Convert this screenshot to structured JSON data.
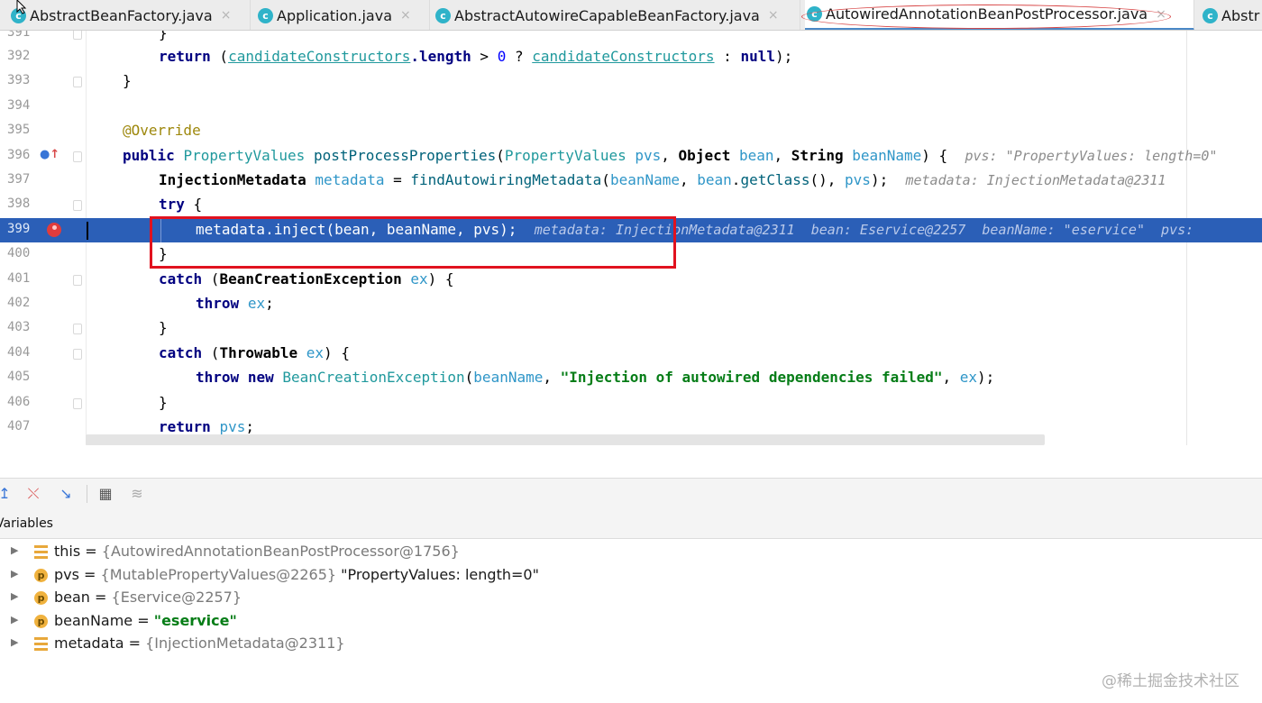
{
  "tabs": [
    {
      "label": "AbstractBeanFactory.java",
      "icon": "class-icon",
      "active": false
    },
    {
      "label": "Application.java",
      "icon": "class-icon",
      "active": false
    },
    {
      "label": "AbstractAutowireCapableBeanFactory.java",
      "icon": "class-icon",
      "active": false
    },
    {
      "label": "AutowiredAnnotationBeanPostProcessor.java",
      "icon": "class-icon",
      "active": true
    },
    {
      "label": "Abstr",
      "icon": "class-icon",
      "active": false
    }
  ],
  "tab_close_glyph": "×",
  "class_icon_letter": "c",
  "code": {
    "line_numbers": [
      "391",
      "392",
      "393",
      "394",
      "395",
      "396",
      "397",
      "398",
      "399",
      "400",
      "401",
      "402",
      "403",
      "404",
      "405",
      "406",
      "407"
    ],
    "l391": {
      "brace": "}"
    },
    "l392": {
      "return": "return",
      "open": " (",
      "field1": "candidateConstructors",
      "dot": ".length",
      "op": " > ",
      "zero": "0",
      "q": " ? ",
      "field2": "candidateConstructors",
      "colon": " : ",
      "null": "null",
      "close": ");"
    },
    "l393": {
      "brace": "}"
    },
    "l395": {
      "annotation": "@Override"
    },
    "l396": {
      "public": "public ",
      "rtype": "PropertyValues",
      "method": "postProcessProperties",
      "p1type": "PropertyValues",
      "p1": "pvs",
      "comma1": ", ",
      "p2type": "Object",
      "p2": "bean",
      "p3type": "String",
      "p3": "beanName",
      "end": ") {",
      "hint": "pvs: \"PropertyValues: length=0\""
    },
    "l397": {
      "type": "InjectionMetadata",
      "var": "metadata",
      "eq": " = ",
      "call": "findAutowiringMetadata",
      "a1": "beanName",
      "a2": "bean",
      "getclass": "getClass",
      "a3": "pvs",
      "end": ");",
      "hint": "metadata: InjectionMetadata@2311"
    },
    "l398": {
      "try": "try",
      "brace": " {"
    },
    "l399": {
      "stmt": "metadata.inject(bean, beanName, pvs);",
      "hint": "metadata: InjectionMetadata@2311  bean: Eservice@2257  beanName: \"eservice\"  pvs:"
    },
    "l400": {
      "brace": "}"
    },
    "l401": {
      "catch": "catch",
      "exc": "BeanCreationException",
      "ex": "ex",
      "end": ") {"
    },
    "l402": {
      "throw": "throw",
      "ex": "ex",
      "end": ";"
    },
    "l403": {
      "brace": "}"
    },
    "l404": {
      "catch": "catch",
      "exc": "Throwable",
      "ex": "ex",
      "end": ") {"
    },
    "l405": {
      "throw": "throw",
      "new": "new",
      "exc": "BeanCreationException",
      "a1": "beanName",
      "msg": "\"Injection of autowired dependencies failed\"",
      "ex": "ex",
      "end": ");"
    },
    "l406": {
      "brace": "}"
    },
    "l407": {
      "return": "return",
      "pvs": "pvs",
      "end": ";"
    }
  },
  "debug": {
    "toolbar": [
      "show-execution-point-icon",
      "drop-frame-icon",
      "step-into-icon",
      "evaluate-grid-icon",
      "trace-icon"
    ],
    "variables_title": "Variables",
    "variables": [
      {
        "icon": "field-list-icon",
        "name": "this",
        "eq": " = ",
        "type": "{AutowiredAnnotationBeanPostProcessor@1756}",
        "value": ""
      },
      {
        "icon": "parameter-icon",
        "name": "pvs",
        "eq": " = ",
        "type": "{MutablePropertyValues@2265}",
        "value": " \"PropertyValues: length=0\""
      },
      {
        "icon": "parameter-icon",
        "name": "bean",
        "eq": " = ",
        "type": "{Eservice@2257}",
        "value": ""
      },
      {
        "icon": "parameter-icon",
        "name": "beanName",
        "eq": " = ",
        "type": "",
        "value": "\"eservice\""
      },
      {
        "icon": "field-list-icon",
        "name": "metadata",
        "eq": " = ",
        "type": "{InjectionMetadata@2311}",
        "value": ""
      }
    ],
    "param_letter": "p"
  },
  "watermark": "@稀土掘金技术社区",
  "colors": {
    "execution_line": "#2b5fb7",
    "highlight_box": "#e1121f",
    "tab_ellipse": "#d84848",
    "active_tab_underline": "#4a88c7"
  }
}
